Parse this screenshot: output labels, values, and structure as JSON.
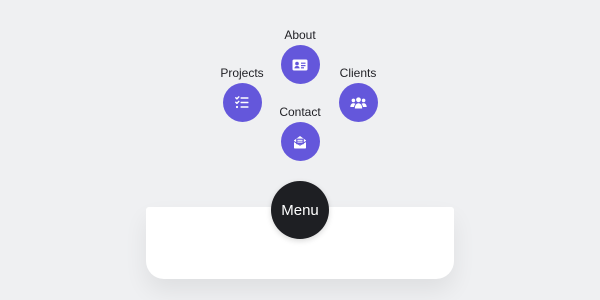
{
  "menu": {
    "toggle_label": "Menu",
    "items": [
      {
        "id": "about",
        "label": "About",
        "icon": "id-card-icon"
      },
      {
        "id": "projects",
        "label": "Projects",
        "icon": "checklist-icon"
      },
      {
        "id": "clients",
        "label": "Clients",
        "icon": "users-icon"
      },
      {
        "id": "contact",
        "label": "Contact",
        "icon": "envelope-open-icon"
      }
    ]
  },
  "colors": {
    "background": "#eff0f2",
    "accent": "#6457db",
    "toggle": "#1e1f23",
    "panel": "#ffffff"
  }
}
